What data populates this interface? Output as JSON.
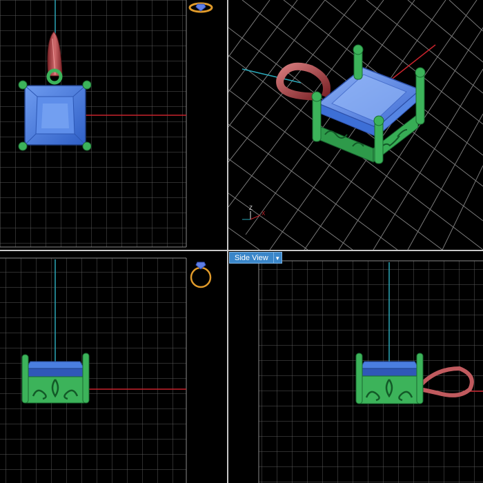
{
  "viewports": {
    "bottom_right": {
      "view_dropdown": {
        "label": "Side View"
      }
    }
  },
  "colors": {
    "grid": "#8a8a8a",
    "axis_x": "#c8232c",
    "axis_y": "#2aa7b8",
    "metal_green": "#3cb35a",
    "gem_blue": "#4a7ee0",
    "bail_red": "#b8484c"
  },
  "icons": [
    "ring-top-view-icon",
    "ring-front-view-icon",
    "axis-triad-icon",
    "dropdown-arrow-icon"
  ]
}
